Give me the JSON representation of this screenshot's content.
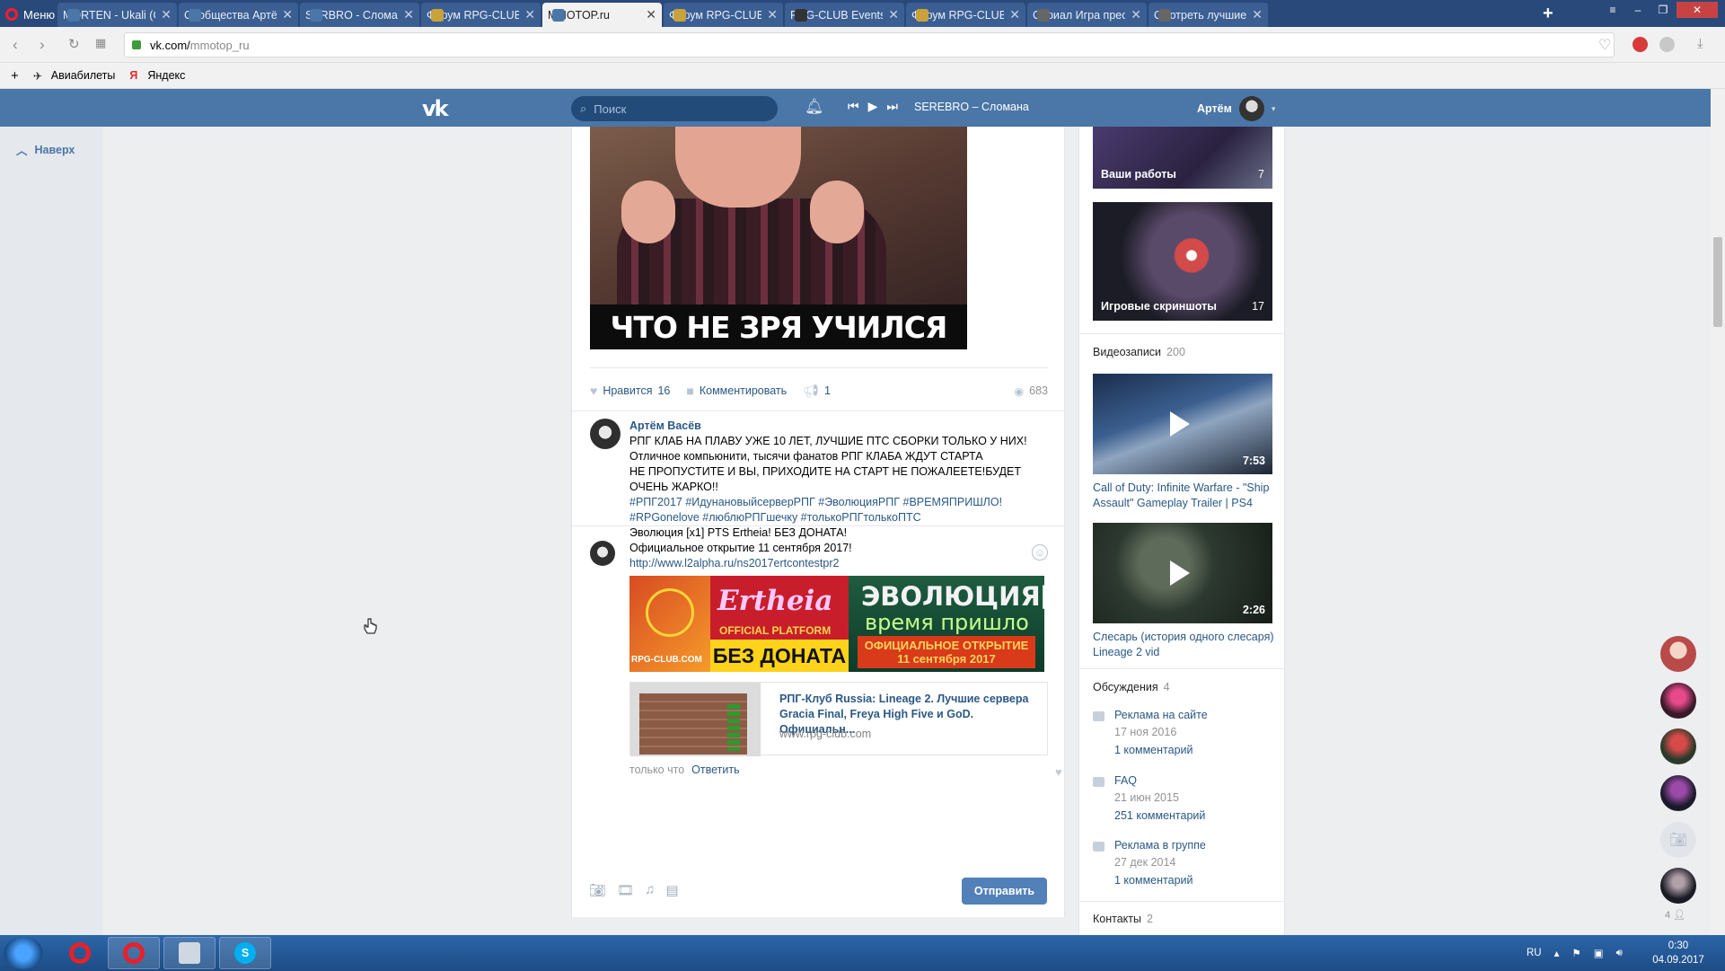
{
  "browser": {
    "menu_label": "Меню",
    "tabs": [
      {
        "title": "MORTEN - Ukali (Ori",
        "color": "#4a76a8"
      },
      {
        "title": "Сообщества Артёма",
        "color": "#4a76a8"
      },
      {
        "title": "SERBRO - Сломана",
        "color": "#4a76a8"
      },
      {
        "title": "Форум RPG-CLUB. Т",
        "color": "#c9a23a"
      },
      {
        "title": "MMOTOP.ru",
        "color": "#4a76a8"
      },
      {
        "title": "Форум RPG-CLUB. Т",
        "color": "#c9a23a"
      },
      {
        "title": "RPG-CLUB Events Sc",
        "color": "#333333"
      },
      {
        "title": "Форум RPG-CLUB. Т",
        "color": "#c9a23a"
      },
      {
        "title": "Сериал Игра прест",
        "color": "#666666"
      },
      {
        "title": "Смотреть лучшие с",
        "color": "#666666"
      }
    ],
    "active_tab": 4,
    "url_host": "vk.com/",
    "url_path": "mmotop_ru",
    "bookmarks": [
      "Авиабилеты",
      "Яндекс"
    ]
  },
  "vk": {
    "search_placeholder": "Поиск",
    "now_playing": "SEREBRO – Сломана",
    "user_name": "Артём",
    "up_label": "Наверх"
  },
  "post": {
    "meme_caption": "ЧТО НЕ ЗРЯ УЧИЛСЯ",
    "like_label": "Нравится",
    "like_count": "16",
    "comment_label": "Комментировать",
    "share_count": "1",
    "views": "683"
  },
  "comment": {
    "author": "Артём Васёв",
    "lines": [
      "РПГ КЛАБ НА ПЛАВУ УЖЕ 10 ЛЕТ, ЛУЧШИЕ ПТС СБОРКИ ТОЛЬКО У НИХ!",
      "Отличное компьюнити, тысячи фанатов РПГ КЛАБА ЖДУТ СТАРТА",
      "НЕ ПРОПУСТИТЕ И ВЫ, ПРИХОДИТЕ НА СТАРТ НЕ ПОЖАЛЕЕТЕ!БУДЕТ",
      "ОЧЕНЬ ЖАРКО!!"
    ],
    "hashtags1": "#РПГ2017 #ИдунановыйсерверРПГ #ЭволюцияРПГ #ВРЕМЯПРИШЛО!",
    "hashtags2": "#RPGonelove #люблюРПГшечку #толькоРПГтолькоПТС",
    "line5": "Эволюция [x1] PTS Ertheia! БЕЗ ДОНАТА!",
    "line6": "Официальное открытие 11 сентября 2017!",
    "link": "http://www.l2alpha.ru/ns2017ertcontestpr2",
    "banner": {
      "logo": "RPG-CLUB.COM",
      "brand": "Ertheia",
      "platform": "OFFICIAL PLATFORM",
      "nodonate": "БЕЗ ДОНАТА",
      "evo": "ЭВОЛЮЦИЯ[x1]",
      "time": "время пришло",
      "open1": "ОФИЦИАЛЬНОЕ ОТКРЫТИЕ",
      "open2": "11 сентября 2017"
    },
    "card_title": "РПГ-Клуб Russia: Lineage 2. Лучшие сервера Gracia Final, Freya High Five и GoD. Официальн...",
    "card_url": "www.rpg-club.com",
    "time": "только что",
    "reply_label": "Ответить"
  },
  "composer": {
    "send_label": "Отправить"
  },
  "sidebar": {
    "album1_label": "Ваши работы",
    "album1_count": "7",
    "album2_label": "Игровые скриншоты",
    "album2_count": "17",
    "videos_label": "Видеозаписи",
    "videos_count": "200",
    "video1_duration": "7:53",
    "video1_title": "Call of Duty: Infinite Warfare - \"Ship Assault\" Gameplay Trailer | PS4",
    "video2_duration": "2:26",
    "video2_title": "Слесарь (история одного слесаря) Lineage 2 vid",
    "discussions_label": "Обсуждения",
    "discussions_count": "4",
    "discussions": [
      {
        "title": "Реклама на сайте",
        "date": "17 ноя 2016",
        "comments": "1 комментарий"
      },
      {
        "title": "FAQ",
        "date": "21 июн 2015",
        "comments": "251 комментарий"
      },
      {
        "title": "Реклама в группе",
        "date": "27 дек 2014",
        "comments": "1 комментарий"
      }
    ],
    "contacts_label": "Контакты",
    "contacts_count": "2"
  },
  "friends_count": "4",
  "taskbar": {
    "lang": "RU",
    "time": "0:30",
    "date": "04.09.2017"
  }
}
